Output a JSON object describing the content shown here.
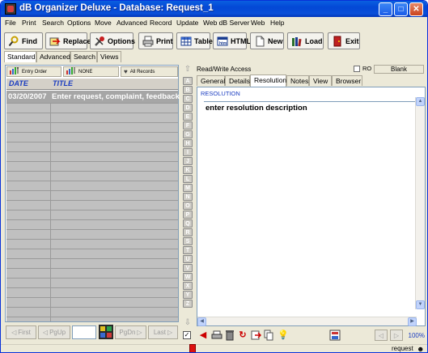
{
  "window": {
    "title": "dB Organizer Deluxe - Database: Request_1"
  },
  "menu": [
    "File",
    "Print",
    "Search",
    "Options",
    "Move",
    "Advanced",
    "Record",
    "Update",
    "Web dB Server",
    "Web",
    "Help"
  ],
  "toolbar": {
    "find": "Find",
    "replace": "Replace",
    "options": "Options",
    "print": "Print",
    "table": "Table",
    "html": "HTML",
    "new": "New",
    "load": "Load",
    "exit": "Exit"
  },
  "view_tabs": [
    "Standard",
    "Advanced",
    "Search",
    "Views"
  ],
  "sort_buttons": [
    "Entry Order",
    "NONE",
    "All Records"
  ],
  "table": {
    "columns": [
      "DATE",
      "TITLE"
    ],
    "rows": [
      {
        "date": "03/20/2007",
        "title": "Enter request, complaint, feedback"
      }
    ]
  },
  "nav": {
    "first": "First",
    "pgup": "PgUp",
    "pgdn": "PgDn",
    "last": "Last"
  },
  "alpha_index": [
    "A",
    "B",
    "C",
    "D",
    "E",
    "F",
    "G",
    "H",
    "I",
    "J",
    "K",
    "L",
    "M",
    "N",
    "O",
    "P",
    "Q",
    "R",
    "S",
    "T",
    "U",
    "V",
    "W",
    "X",
    "Y",
    "Z"
  ],
  "record": {
    "access": "Read/Write Access",
    "ro_label": "RO",
    "blank_label": "Blank",
    "tabs": [
      "General",
      "Details",
      "Resolution",
      "Notes",
      "View",
      "Browser"
    ],
    "active_tab": "Resolution",
    "field_label": "RESOLUTION",
    "field_value": "enter resolution description"
  },
  "zoom": "100%",
  "status": "request",
  "colors": {
    "title_bar": "#0348d6",
    "grid_bg": "#c0c0c0",
    "header_text": "#1a3cc0"
  }
}
